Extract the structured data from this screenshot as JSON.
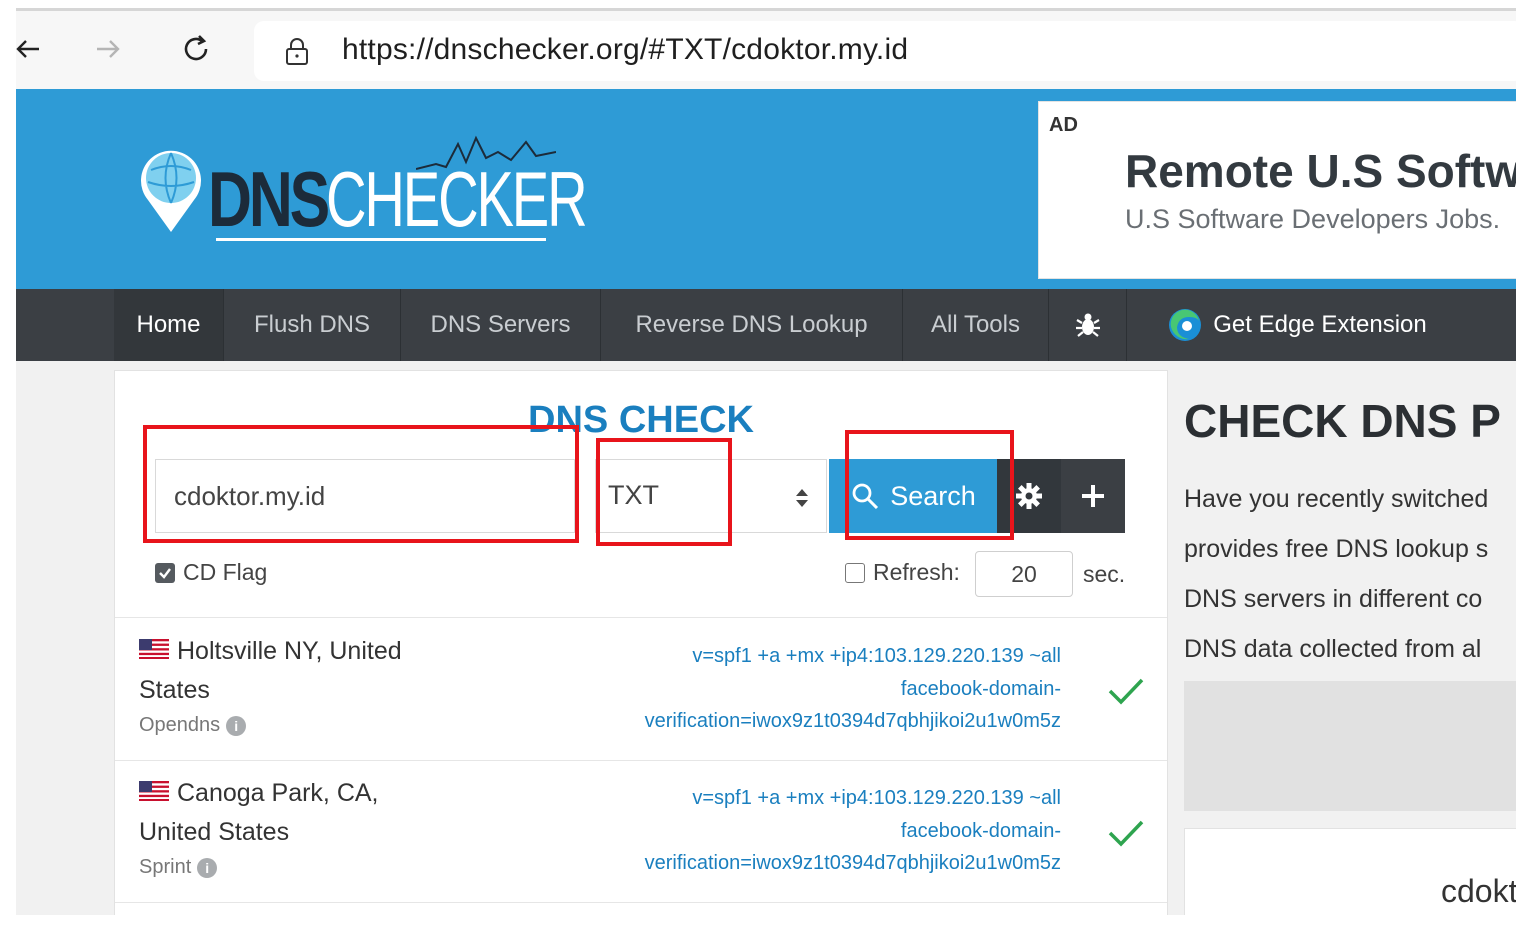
{
  "browser": {
    "url": "https://dnschecker.org/#TXT/cdoktor.my.id"
  },
  "header": {
    "logo_dns": "DNS",
    "logo_checker": "CHECKER",
    "ad": {
      "label": "AD",
      "title": "Remote U.S Softw",
      "subtitle": "U.S Software Developers Jobs."
    }
  },
  "nav": {
    "items": [
      "Home",
      "Flush DNS",
      "DNS Servers",
      "Reverse DNS Lookup",
      "All Tools"
    ],
    "edge": "Get Edge Extension"
  },
  "search": {
    "title": "DNS CHECK",
    "domain": "cdoktor.my.id",
    "record_type": "TXT",
    "button": "Search",
    "cd_flag": "CD Flag",
    "cd_flag_checked": true,
    "refresh_label": "Refresh:",
    "refresh_checked": false,
    "refresh_value": "20",
    "refresh_unit": "sec."
  },
  "results": [
    {
      "location": "Holtsville NY, United States",
      "provider": "Opendns",
      "line1": "v=spf1 +a +mx +ip4:103.129.220.139 ~all",
      "line2": "facebook-domain-",
      "line3": "verification=iwox9z1t0394d7qbhjikoi2u1w0m5z",
      "status": "ok"
    },
    {
      "location": "Canoga Park, CA, United States",
      "provider": "Sprint",
      "line1": "v=spf1 +a +mx +ip4:103.129.220.139 ~all",
      "line2": "facebook-domain-",
      "line3": "verification=iwox9z1t0394d7qbhjikoi2u1w0m5z",
      "status": "ok"
    }
  ],
  "sidebar": {
    "title": "CHECK DNS P",
    "lines": [
      "Have you recently switched",
      "provides free DNS lookup s",
      "DNS servers in different co",
      "DNS data collected from al"
    ],
    "card_text": "cdokt"
  },
  "colors": {
    "header_blue": "#2e9bd6",
    "nav_dark": "#3b3f44",
    "link_blue": "#1a7fbf",
    "check_green": "#2ea44f",
    "highlight_red": "#e8141b"
  }
}
